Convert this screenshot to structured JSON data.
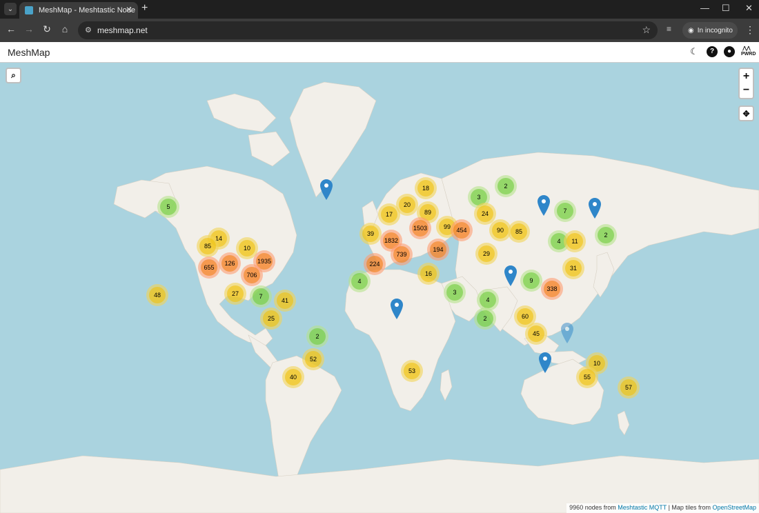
{
  "browser": {
    "tab_title": "MeshMap - Meshtastic Node M",
    "url": "meshmap.net",
    "incognito_label": "In incognito"
  },
  "header": {
    "brand": "MeshMap",
    "icons": [
      "moon-icon",
      "help-icon",
      "github-icon",
      "pwrd-logo"
    ]
  },
  "map": {
    "controls": [
      "search-button",
      "zoom-in-button",
      "zoom-out-button",
      "locate-button"
    ],
    "clusters": [
      {
        "count": "5",
        "level": "small"
      },
      {
        "count": "14",
        "level": "med"
      },
      {
        "count": "85",
        "level": "med"
      },
      {
        "count": "10",
        "level": "med"
      },
      {
        "count": "655",
        "level": "large"
      },
      {
        "count": "126",
        "level": "large"
      },
      {
        "count": "1935",
        "level": "large"
      },
      {
        "count": "706",
        "level": "large"
      },
      {
        "count": "48",
        "level": "med"
      },
      {
        "count": "27",
        "level": "med"
      },
      {
        "count": "7",
        "level": "small"
      },
      {
        "count": "41",
        "level": "med"
      },
      {
        "count": "25",
        "level": "med"
      },
      {
        "count": "2",
        "level": "small"
      },
      {
        "count": "52",
        "level": "med"
      },
      {
        "count": "40",
        "level": "med"
      },
      {
        "count": "4",
        "level": "small"
      },
      {
        "count": "39",
        "level": "med"
      },
      {
        "count": "17",
        "level": "med"
      },
      {
        "count": "20",
        "level": "med"
      },
      {
        "count": "18",
        "level": "med"
      },
      {
        "count": "89",
        "level": "med"
      },
      {
        "count": "1503",
        "level": "large"
      },
      {
        "count": "99",
        "level": "med"
      },
      {
        "count": "454",
        "level": "large"
      },
      {
        "count": "1832",
        "level": "large"
      },
      {
        "count": "739",
        "level": "large"
      },
      {
        "count": "194",
        "level": "large"
      },
      {
        "count": "224",
        "level": "large"
      },
      {
        "count": "16",
        "level": "med"
      },
      {
        "count": "3",
        "level": "small"
      },
      {
        "count": "53",
        "level": "med"
      },
      {
        "count": "3",
        "level": "small"
      },
      {
        "count": "24",
        "level": "med"
      },
      {
        "count": "2",
        "level": "small"
      },
      {
        "count": "90",
        "level": "med"
      },
      {
        "count": "85",
        "level": "med"
      },
      {
        "count": "29",
        "level": "med"
      },
      {
        "count": "7",
        "level": "small"
      },
      {
        "count": "4",
        "level": "small"
      },
      {
        "count": "11",
        "level": "med"
      },
      {
        "count": "2",
        "level": "small"
      },
      {
        "count": "31",
        "level": "med"
      },
      {
        "count": "9",
        "level": "small"
      },
      {
        "count": "338",
        "level": "large"
      },
      {
        "count": "4",
        "level": "small"
      },
      {
        "count": "2",
        "level": "small"
      },
      {
        "count": "60",
        "level": "med"
      },
      {
        "count": "45",
        "level": "med"
      },
      {
        "count": "10",
        "level": "med"
      },
      {
        "count": "55",
        "level": "med"
      },
      {
        "count": "57",
        "level": "med"
      }
    ],
    "attribution": {
      "prefix": "9960 nodes from",
      "mqtt_link": "Meshtastic MQTT",
      "separator": " | Map tiles from ",
      "osm_link": "OpenStreetMap"
    }
  }
}
